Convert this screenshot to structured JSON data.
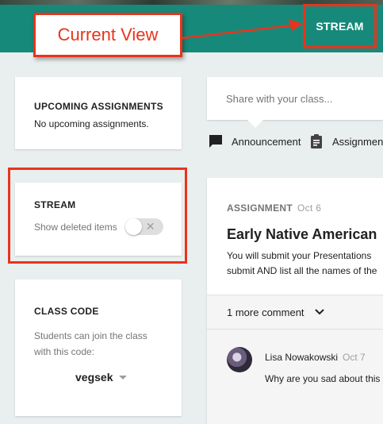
{
  "annotation": {
    "callout_label": "Current View"
  },
  "header": {
    "stream_tab_label": "STREAM"
  },
  "sidebar": {
    "upcoming": {
      "title": "UPCOMING ASSIGNMENTS",
      "message": "No upcoming assignments."
    },
    "stream": {
      "title": "STREAM",
      "toggle_label": "Show deleted items",
      "toggle_on": false
    },
    "class_code": {
      "title": "CLASS CODE",
      "description": "Students can join the class with this code:",
      "code": "vegsek"
    }
  },
  "composer": {
    "placeholder": "Share with your class...",
    "actions": [
      {
        "label": "Announcement",
        "icon": "announcement-icon"
      },
      {
        "label": "Assignment",
        "icon": "assignment-clipboard-icon"
      }
    ]
  },
  "post": {
    "type": "ASSIGNMENT",
    "date": "Oct 6",
    "title": "Early Native American",
    "body_lines": [
      "You will submit your Presentations",
      "submit AND list all the names of the"
    ],
    "comment_toggle": "1 more comment",
    "comment": {
      "author": "Lisa Nowakowski",
      "date": "Oct 7",
      "text": "Why are you sad about this"
    }
  },
  "colors": {
    "header_teal": "#17897a",
    "annotation_red": "#e8341c",
    "page_bg": "#e9eeee"
  }
}
